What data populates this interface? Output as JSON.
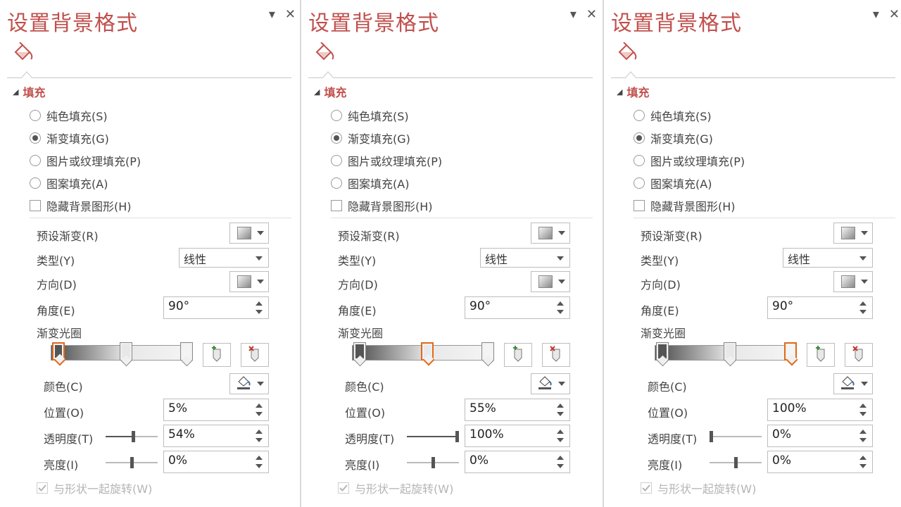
{
  "colors": {
    "title": "#c0504d",
    "section": "#c0504d",
    "selected_stop": "#e06a1a"
  },
  "panels": [
    {
      "title": "设置背景格式",
      "icons": {
        "pin": "▾",
        "close": "✕",
        "tab": "paint-bucket-icon"
      },
      "section": "填充",
      "fill_options": [
        {
          "label": "纯色填充(S)",
          "selected": false
        },
        {
          "label": "渐变填充(G)",
          "selected": true
        },
        {
          "label": "图片或纹理填充(P)",
          "selected": false
        },
        {
          "label": "图案填充(A)",
          "selected": false
        }
      ],
      "hide_bg_label": "隐藏背景图形(H)",
      "preset_label": "预设渐变(R)",
      "type_label": "类型(Y)",
      "type_value": "线性",
      "direction_label": "方向(D)",
      "angle_label": "角度(E)",
      "angle_value": "90°",
      "stops_label": "渐变光圈",
      "stops": [
        {
          "position": 0.05,
          "color": "#555555",
          "selected": true
        },
        {
          "position": 0.55,
          "color": "#e8e8e8",
          "selected": false
        },
        {
          "position": 1.0,
          "color": "#f4f4f4",
          "selected": false
        }
      ],
      "color_label": "颜色(C)",
      "position_label": "位置(O)",
      "position_value": "5%",
      "transparency_label": "透明度(T)",
      "transparency_value": "54%",
      "transparency_level": 0.54,
      "brightness_label": "亮度(I)",
      "brightness_value": "0%",
      "brightness_level": 0.5,
      "rotate_label": "与形状一起旋转(W)"
    },
    {
      "title": "设置背景格式",
      "icons": {
        "pin": "▾",
        "close": "✕",
        "tab": "paint-bucket-icon"
      },
      "section": "填充",
      "fill_options": [
        {
          "label": "纯色填充(S)",
          "selected": false
        },
        {
          "label": "渐变填充(G)",
          "selected": true
        },
        {
          "label": "图片或纹理填充(P)",
          "selected": false
        },
        {
          "label": "图案填充(A)",
          "selected": false
        }
      ],
      "hide_bg_label": "隐藏背景图形(H)",
      "preset_label": "预设渐变(R)",
      "type_label": "类型(Y)",
      "type_value": "线性",
      "direction_label": "方向(D)",
      "angle_label": "角度(E)",
      "angle_value": "90°",
      "stops_label": "渐变光圈",
      "stops": [
        {
          "position": 0.05,
          "color": "#555555",
          "selected": false
        },
        {
          "position": 0.55,
          "color": "#e8e8e8",
          "selected": true
        },
        {
          "position": 1.0,
          "color": "#f4f4f4",
          "selected": false
        }
      ],
      "color_label": "颜色(C)",
      "position_label": "位置(O)",
      "position_value": "55%",
      "transparency_label": "透明度(T)",
      "transparency_value": "100%",
      "transparency_level": 1.0,
      "brightness_label": "亮度(I)",
      "brightness_value": "0%",
      "brightness_level": 0.5,
      "rotate_label": "与形状一起旋转(W)"
    },
    {
      "title": "设置背景格式",
      "icons": {
        "pin": "▾",
        "close": "✕",
        "tab": "paint-bucket-icon"
      },
      "section": "填充",
      "fill_options": [
        {
          "label": "纯色填充(S)",
          "selected": false
        },
        {
          "label": "渐变填充(G)",
          "selected": true
        },
        {
          "label": "图片或纹理填充(P)",
          "selected": false
        },
        {
          "label": "图案填充(A)",
          "selected": false
        }
      ],
      "hide_bg_label": "隐藏背景图形(H)",
      "preset_label": "预设渐变(R)",
      "type_label": "类型(Y)",
      "type_value": "线性",
      "direction_label": "方向(D)",
      "angle_label": "角度(E)",
      "angle_value": "90°",
      "stops_label": "渐变光圈",
      "stops": [
        {
          "position": 0.05,
          "color": "#555555",
          "selected": false
        },
        {
          "position": 0.55,
          "color": "#e8e8e8",
          "selected": false
        },
        {
          "position": 1.0,
          "color": "#f4f4f4",
          "selected": true
        }
      ],
      "color_label": "颜色(C)",
      "position_label": "位置(O)",
      "position_value": "100%",
      "transparency_label": "透明度(T)",
      "transparency_value": "0%",
      "transparency_level": 0.0,
      "brightness_label": "亮度(I)",
      "brightness_value": "0%",
      "brightness_level": 0.5,
      "rotate_label": "与形状一起旋转(W)"
    }
  ]
}
